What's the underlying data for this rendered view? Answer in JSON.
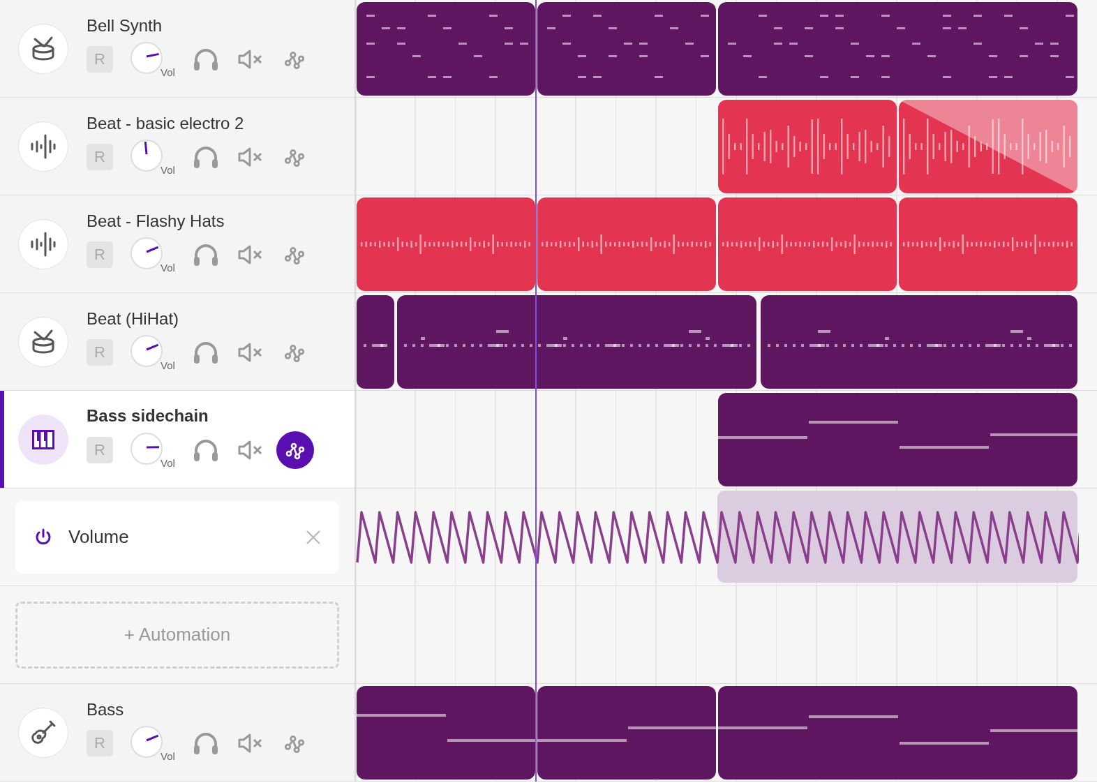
{
  "tracks": [
    {
      "name": "Bell Synth",
      "kind": "drum",
      "selected": false,
      "record": "R",
      "knob_label": "Vol",
      "level": 0.79,
      "automation_on": false,
      "clips": [
        {
          "kind": "midi",
          "fade": false
        },
        {
          "kind": "midi",
          "fade": false
        },
        {
          "kind": "midi",
          "fade": false
        }
      ]
    },
    {
      "name": "Beat - basic electro 2",
      "kind": "wave",
      "selected": false,
      "record": "R",
      "knob_label": "Vol",
      "level": 0.48,
      "automation_on": false,
      "clips": [
        {
          "kind": "audio",
          "fade": false
        },
        {
          "kind": "audio",
          "fade": true
        }
      ]
    },
    {
      "name": "Beat - Flashy Hats",
      "kind": "wave",
      "selected": false,
      "record": "R",
      "knob_label": "Vol",
      "level": 0.75,
      "automation_on": false,
      "clips": [
        {
          "kind": "audio",
          "fade": false
        },
        {
          "kind": "audio",
          "fade": false
        },
        {
          "kind": "audio",
          "fade": false
        },
        {
          "kind": "audio",
          "fade": false
        }
      ]
    },
    {
      "name": "Beat (HiHat)",
      "kind": "drum",
      "selected": false,
      "record": "R",
      "knob_label": "Vol",
      "level": 0.75,
      "automation_on": false,
      "clips": [
        {
          "kind": "midi",
          "fade": false
        },
        {
          "kind": "midi",
          "fade": false
        },
        {
          "kind": "midi",
          "fade": false
        }
      ]
    },
    {
      "name": "Bass sidechain",
      "kind": "piano",
      "selected": true,
      "record": "R",
      "knob_label": "Vol",
      "level": 0.83,
      "automation_on": true,
      "clips": [
        {
          "kind": "midi",
          "fade": false
        }
      ],
      "automation_lanes": [
        {
          "label": "Volume",
          "enabled": true
        }
      ],
      "add_automation": "+ Automation"
    },
    {
      "name": "Bass",
      "kind": "guitar",
      "selected": false,
      "record": "R",
      "knob_label": "Vol",
      "level": 0.75,
      "automation_on": false,
      "clips": [
        {
          "kind": "midi",
          "fade": false
        },
        {
          "kind": "midi",
          "fade": false
        },
        {
          "kind": "midi",
          "fade": false
        }
      ]
    }
  ]
}
